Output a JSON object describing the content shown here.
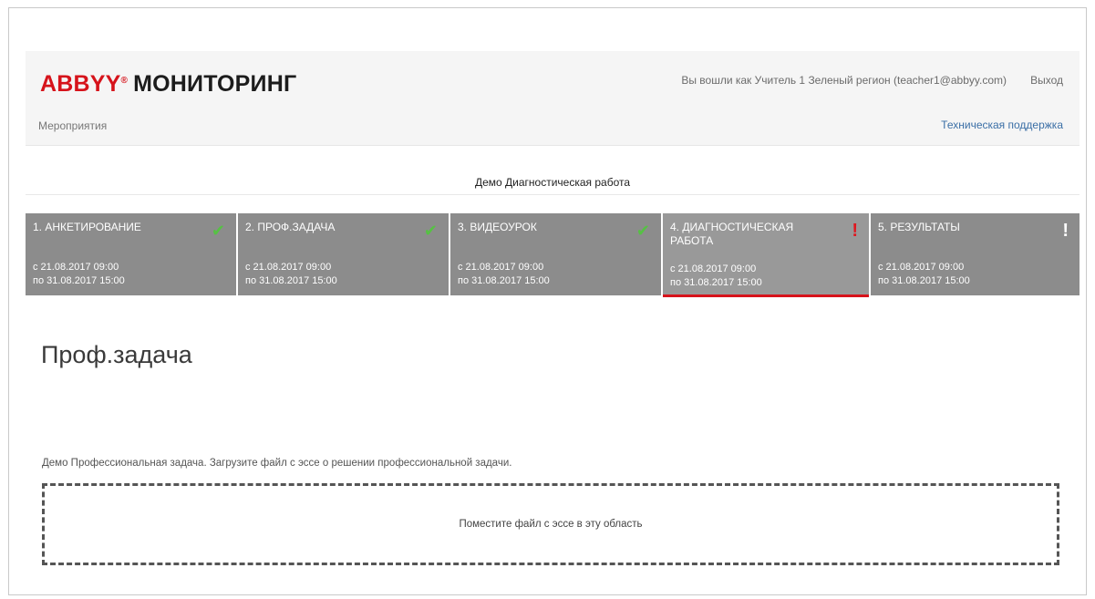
{
  "header": {
    "logo_brand": "ABBYY",
    "logo_tm": "®",
    "logo_product": "МОНИТОРИНГ",
    "user_info": "Вы вошли как Учитель 1 Зеленый регион (teacher1@abbyy.com)",
    "logout_label": "Выход",
    "nav_events": "Мероприятия",
    "support_label": "Техническая поддержка"
  },
  "event": {
    "title": "Демо Диагностическая работа"
  },
  "steps": [
    {
      "title": "1. АНКЕТИРОВАНИЕ",
      "from": "с 21.08.2017 09:00",
      "to": "по 31.08.2017 15:00",
      "status": "check-icon"
    },
    {
      "title": "2. ПРОФ.ЗАДАЧА",
      "from": "с 21.08.2017 09:00",
      "to": "по 31.08.2017 15:00",
      "status": "check-icon"
    },
    {
      "title": "3. ВИДЕОУРОК",
      "from": "с 21.08.2017 09:00",
      "to": "по 31.08.2017 15:00",
      "status": "check-icon"
    },
    {
      "title": "4. ДИАГНОСТИЧЕСКАЯ РАБОТА",
      "from": "с 21.08.2017 09:00",
      "to": "по 31.08.2017 15:00",
      "status": "exclamation-icon-red"
    },
    {
      "title": "5. РЕЗУЛЬТАТЫ",
      "from": "с 21.08.2017 09:00",
      "to": "по 31.08.2017 15:00",
      "status": "exclamation-icon-white"
    }
  ],
  "glyphs": {
    "check": "✔",
    "exclamation": "!"
  },
  "main": {
    "heading": "Проф.задача",
    "description": "Демо Профессиональная задача. Загрузите файл с эссе о решении профессиональной задачи.",
    "dropzone_text": "Поместите файл с эссе в эту область"
  },
  "colors": {
    "brand_red": "#d6131b",
    "step_bg": "#8c8c8c",
    "check_green": "#56c144",
    "link_blue": "#3b6fa6"
  }
}
